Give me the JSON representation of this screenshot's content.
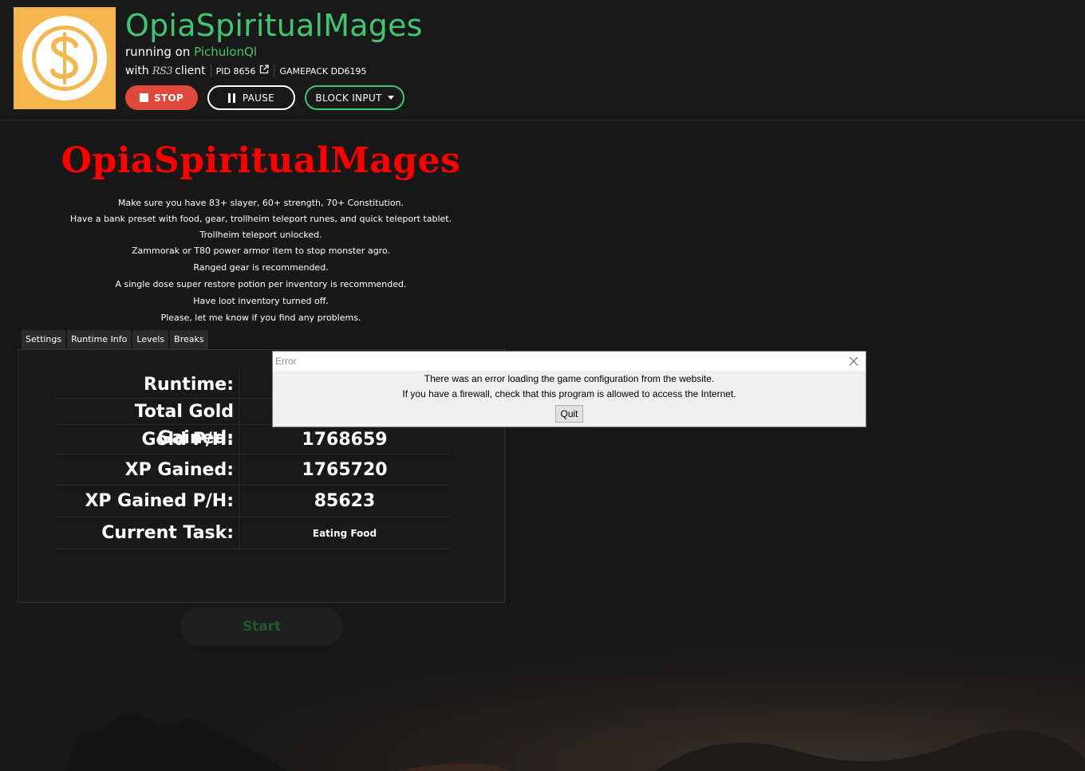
{
  "header": {
    "script_name": "OpiaSpiritualMages",
    "running_prefix": "running on",
    "account": "PichulonQl",
    "with_prefix": "with",
    "client_logo_text": "RS3",
    "client_suffix": "client",
    "pid": "PID 8656",
    "gamepack": "GAMEPACK DD6195",
    "logo_icon": "dollar-coin-icon",
    "external_link_icon": "external-link-icon"
  },
  "controls": {
    "stop_label": "STOP",
    "pause_label": "PAUSE",
    "block_input_label": "BLOCK INPUT"
  },
  "script_page": {
    "title": "OpiaSpiritualMages",
    "instructions": [
      "Make sure you have 83+ slayer,  60+ strength, 70+ Constitution.",
      "Have a bank preset with food, gear, trollheim teleport runes, and quick teleport tablet.",
      "Trollheim teleport unlocked.",
      "Zammorak or T80 power armor item to stop monster agro.",
      "Ranged gear is recommended.",
      "A single dose super restore potion per inventory is recommended.",
      "Have loot inventory turned off.",
      "Please, let me know if you find any problems."
    ],
    "tabs": [
      "Settings",
      "Runtime Info",
      "Levels",
      "Breaks"
    ],
    "stats": [
      {
        "label": "Runtime:",
        "value": ""
      },
      {
        "label": "Total Gold Gained:",
        "value": ""
      },
      {
        "label": "Gold P/H:",
        "value": "1768659"
      },
      {
        "label": "XP Gained:",
        "value": "1765720"
      },
      {
        "label": "XP Gained P/H:",
        "value": "85623"
      },
      {
        "label": "Current Task:",
        "value": "Eating Food"
      }
    ],
    "start_label": "Start"
  },
  "error_dialog": {
    "title": "Error",
    "message_line1": "There was an error loading the game configuration from the website.",
    "message_line2": "If you have a firewall, check that this program is allowed to access the Internet.",
    "quit_label": "Quit"
  },
  "colors": {
    "accent_green": "#3fc671",
    "stop_red": "#e0483b",
    "title_red": "#ff0000",
    "logo_orange": "#f5b64e",
    "background": "#1a1a1a"
  }
}
